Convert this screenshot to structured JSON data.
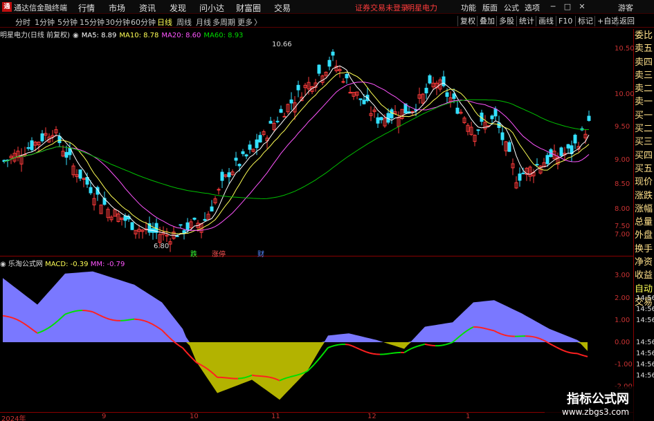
{
  "titlebar": {
    "logo": "通",
    "app_name": "通达信金融终端",
    "menus": [
      "行情",
      "市场",
      "资讯",
      "发现",
      "问小达",
      "财富圈",
      "交易"
    ],
    "notice": "证券交易未登录",
    "stock_name": "明星电力",
    "right_menus": [
      "功能",
      "版面",
      "公式",
      "选项"
    ],
    "guest": "游客",
    "win_buttons": [
      "─",
      "□",
      "✕"
    ]
  },
  "toolbar": {
    "periods": [
      "分时",
      "1分钟",
      "5分钟",
      "15分钟",
      "30分钟",
      "60分钟",
      "日线",
      "周线",
      "月线",
      "多周期",
      "更多"
    ],
    "active_period": "日线",
    "more_arrow": "〉",
    "right_buttons": [
      "复权",
      "叠加",
      "多股",
      "统计",
      "画线",
      "F10",
      "标记",
      "+自选",
      "返回"
    ]
  },
  "main_chart": {
    "header": {
      "title": "明星电力(日线 前复权)",
      "ma5": "MA5: 8.89",
      "ma10": "MA10: 8.78",
      "ma20": "MA20: 8.60",
      "ma60": "MA60: 8.93"
    },
    "high_label": "10.66",
    "low_label": "6.80",
    "price_ticks": [
      "10.50",
      "10.00",
      "9.50",
      "9.00",
      "8.50",
      "8.00",
      "7.50",
      "7.00"
    ],
    "tags": [
      "跌",
      "涨停",
      "财"
    ],
    "colors": {
      "up": "#ff3b3b",
      "down": "#33e0ff",
      "ma5": "#ffffff",
      "ma10": "#ffff55",
      "ma20": "#ff55ff",
      "ma60": "#00c000"
    }
  },
  "sub_chart": {
    "header": {
      "title": "乐淘公式网",
      "macd": "MACD: -0.39",
      "mm": "MM: -0.79"
    },
    "value_ticks": [
      "3.00",
      "2.00",
      "1.00",
      "0.00",
      "-1.00",
      "-2.00"
    ],
    "colors": {
      "positive_area": "#7a78ff",
      "negative_area": "#b3b300"
    }
  },
  "time_axis": {
    "labels": [
      "2024年",
      "9",
      "10",
      "11",
      "12",
      "1"
    ]
  },
  "side_panel": {
    "items": [
      "委比",
      "卖五",
      "卖四",
      "卖三",
      "卖二",
      "卖一",
      "买一",
      "买二",
      "买三",
      "买四",
      "买五",
      "现价",
      "涨跌",
      "涨幅",
      "总量",
      "外盘",
      "换手",
      "净资",
      "收益"
    ],
    "auto_label": "自动",
    "trade_label": "交易",
    "times": [
      "14:56",
      "14:56",
      "14:56",
      "14:56",
      "14:56",
      "14:56",
      "14:56"
    ]
  },
  "watermark": {
    "line1": "指标公式网",
    "line2": "www.zbgs3.com"
  }
}
